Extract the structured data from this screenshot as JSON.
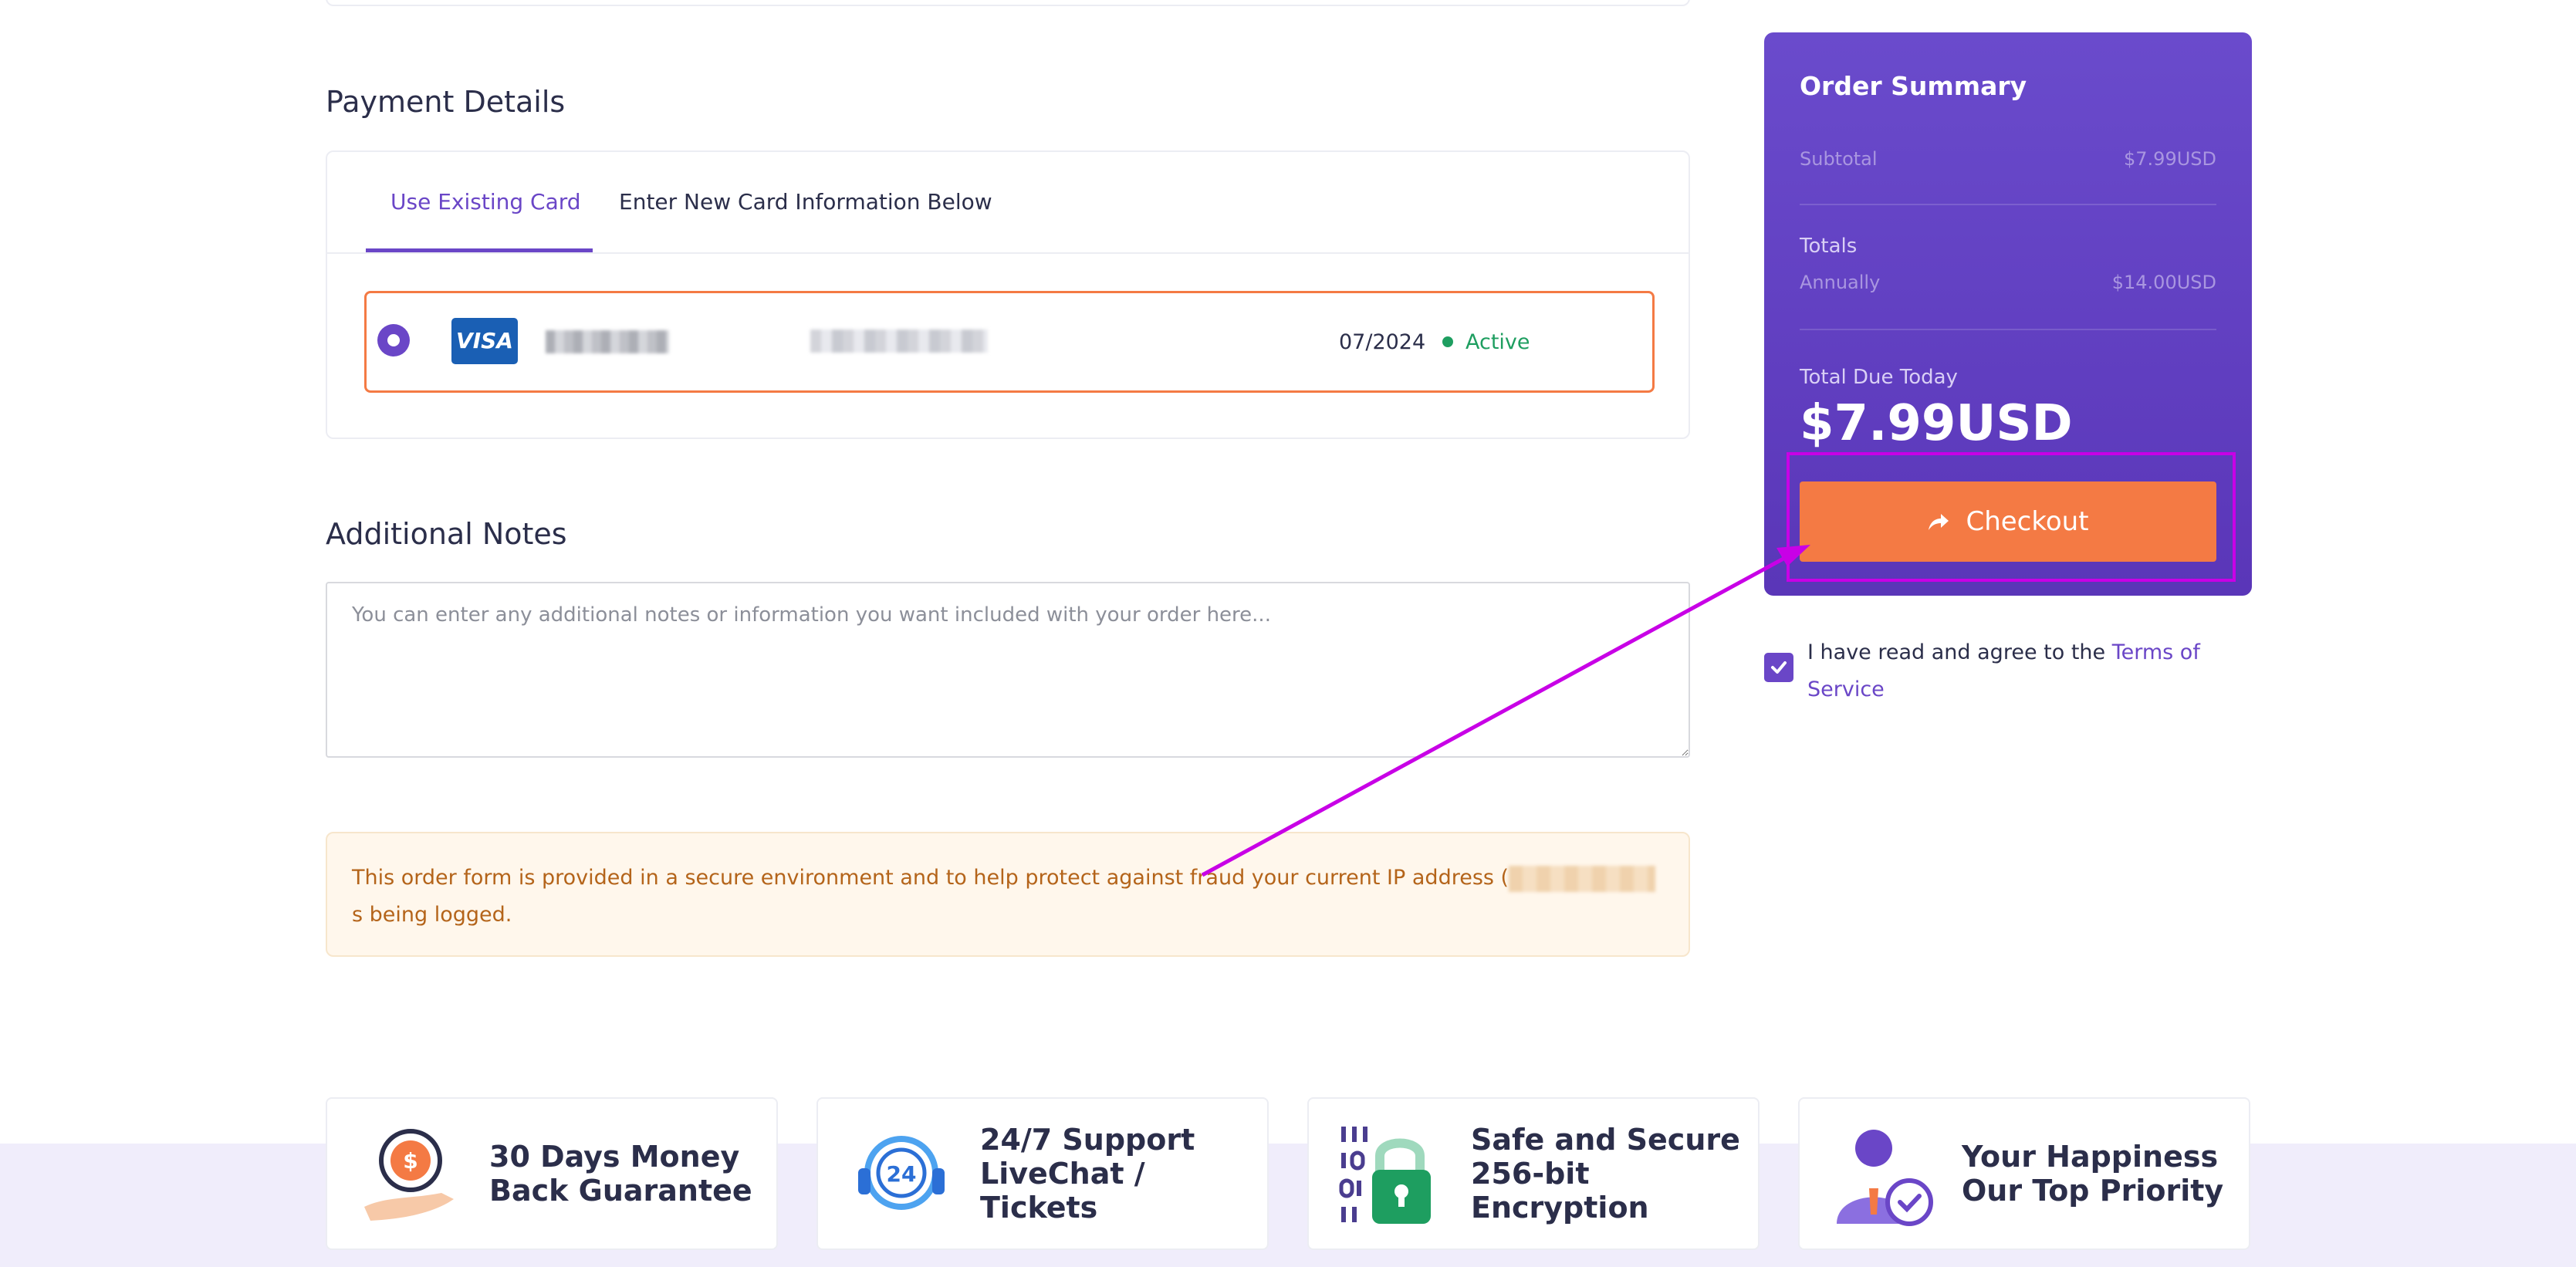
{
  "payment": {
    "title": "Payment Details",
    "tabs": [
      "Use Existing Card",
      "Enter New Card Information Below"
    ],
    "card": {
      "brand": "VISA",
      "expiry": "07/2024",
      "status": "Active"
    }
  },
  "notes": {
    "title": "Additional Notes",
    "placeholder": "You can enter any additional notes or information you want included with your order here..."
  },
  "security_notice": {
    "text_before": "This order form is provided in a secure environment and to help protect against fraud your current IP address (",
    "text_after": "s being logged."
  },
  "summary": {
    "title": "Order Summary",
    "subtotal_label": "Subtotal",
    "subtotal_value": "$7.99USD",
    "totals_label": "Totals",
    "annually_label": "Annually",
    "annually_value": "$14.00USD",
    "due_label": "Total Due Today",
    "due_amount": "$7.99USD",
    "checkout_label": "Checkout"
  },
  "tos": {
    "text": "I have read and agree to the ",
    "link": "Terms of Service"
  },
  "features": [
    {
      "line1": "30 Days Money",
      "line2": "Back Guarantee",
      "line3": "",
      "icon": "money-back-icon"
    },
    {
      "line1": "24/7 Support",
      "line2": "LiveChat /",
      "line3": "Tickets",
      "icon": "support-headset-icon"
    },
    {
      "line1": "Safe and Secure",
      "line2": "256-bit",
      "line3": "Encryption",
      "icon": "padlock-icon"
    },
    {
      "line1": "Your Happiness",
      "line2": "Our Top Priority",
      "line3": "",
      "icon": "happy-customer-icon"
    }
  ],
  "colors": {
    "accent": "#6a46c7",
    "checkout": "#f47a44",
    "success": "#1e9e60",
    "annotation": "#c800e6"
  }
}
